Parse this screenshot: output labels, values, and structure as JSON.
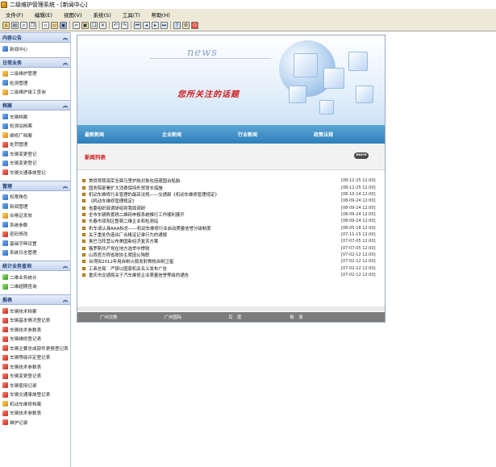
{
  "window": {
    "title": "二级维护管理系统 - [新闻中心]"
  },
  "menu": [
    "文件(F)",
    "编辑(E)",
    "视图(V)",
    "系统(S)",
    "工具(T)",
    "帮助(H)"
  ],
  "sidebar": {
    "sections": [
      {
        "title": "内容公告",
        "items": [
          "新闻中心"
        ]
      },
      {
        "title": "日常业务",
        "items": [
          "二级维护管理",
          "检测管理",
          "二级维护竣工查询"
        ]
      },
      {
        "title": "档案",
        "items": [
          "车辆档案",
          "检测站档案",
          "维修厂档案",
          "处罚管理",
          "车辆变更登记",
          "车辆变更登记",
          "车辆交通事故登记"
        ]
      },
      {
        "title": "管理",
        "items": [
          "权限角色",
          "新闻管理",
          "合格证发放",
          "系统参数",
          "密码修改",
          "基础字典设置",
          "系统日志管理"
        ]
      },
      {
        "title": "统计业务查询",
        "items": [
          "二维业务统计",
          "二维超期查询"
        ]
      },
      {
        "title": "报表",
        "items": [
          "车辆技术档案",
          "车辆基本情况登记表",
          "车辆技术参数表",
          "车辆维修登记表",
          "车辆主要总成部件更换登记表",
          "车辆等级评定登记表",
          "车辆技术参数表",
          "车辆变更登记表",
          "车辆使用记录",
          "车辆交通事故登记表",
          "机动车维修档案",
          "车辆技术参数表",
          "维护记录"
        ]
      }
    ]
  },
  "banner": {
    "word": "news",
    "slogan": "您所关注的话题"
  },
  "nav": [
    "最新新闻",
    "企业新闻",
    "行业新闻",
    "政策法规"
  ],
  "list": {
    "title": "新闻列表",
    "more": "more"
  },
  "news": [
    {
      "text": "首员称我海军全面马里护航对象包括德国台船舶",
      "date": "[08-12-25 12:00]"
    },
    {
      "text": "国务院部署扩大消费保持外贸增长措施",
      "date": "[08-12-25 12:00]"
    },
    {
      "text": "机动车维修行业管理的最高法规——交通部《机动车维修管理规定》",
      "date": "[08-10-14 12:00]"
    },
    {
      "text": "《机动车维修管理规定》",
      "date": "[08-09-24 12:00]"
    },
    {
      "text": "省委组织部调研组到我局调研",
      "date": "[08-09-24 12:00]"
    },
    {
      "text": "全市车辆购置税二维码申报系统推行工作顺利展开",
      "date": "[08-09-24 12:00]"
    },
    {
      "text": "长春市双阳区整顿二维企业和检测站",
      "date": "[08-09-24 12:00]"
    },
    {
      "text": "析车请认准AAA标志——机动车维修行业启动质量信誉分级制度",
      "date": "[08-05-18 12:00]"
    },
    {
      "text": "关于重处伪造出厂合格证记录行为的通报",
      "date": "[07-11-15 12:00]"
    },
    {
      "text": "奥巴马阵营公布美国新经济复苏方案",
      "date": "[07-07-05 12:00]"
    },
    {
      "text": "俄罗斯共产党在地方选举中惨败",
      "date": "[07-07-05 12:00]"
    },
    {
      "text": "山西官方称省政协主席因公殉职",
      "date": "[07-02-12 12:00]"
    },
    {
      "text": "台湾拟2012年用自制火箭发射首枚自制卫星",
      "date": "[07-02-12 12:00]"
    },
    {
      "text": "工商总局：严禁以国家机关名义发布广告",
      "date": "[07-02-12 12:00]"
    },
    {
      "text": "重庆市交通局关于汽车维修企业质量信誉等级的通告",
      "date": "[07-02-12 12:00]"
    }
  ],
  "footer": [
    "广州交数",
    "广州国际",
    "百　度",
    "新　浪"
  ]
}
